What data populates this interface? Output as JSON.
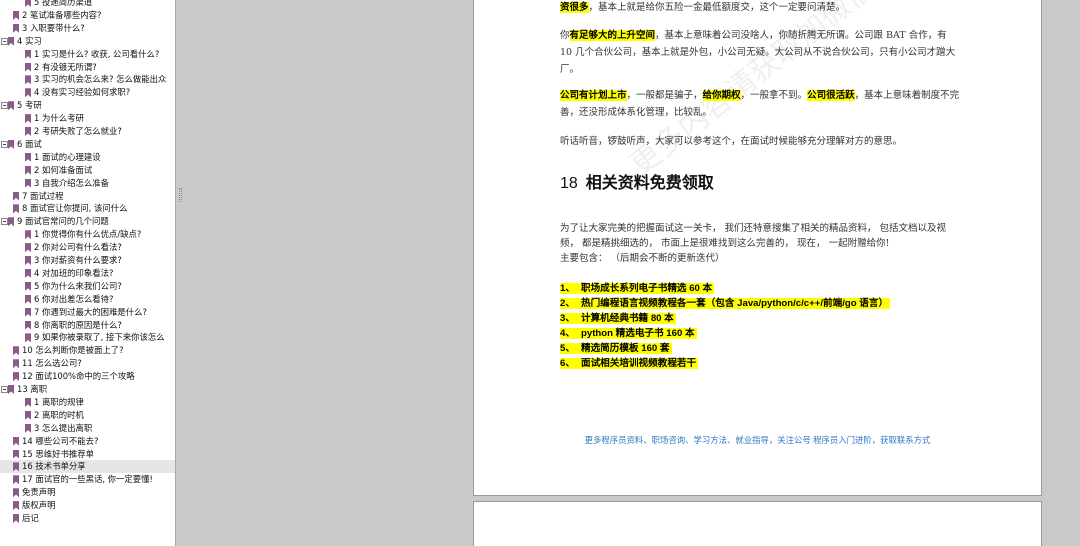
{
  "sidebar": {
    "items": [
      {
        "label": "5 投递简历渠道",
        "level": 2
      },
      {
        "label": "2 笔试准备哪些内容?",
        "level": 1
      },
      {
        "label": "3 入职要带什么?",
        "level": 1
      },
      {
        "label": "4 实习",
        "level": 0,
        "toggle": true
      },
      {
        "label": "1 实习是什么? 收获, 公司看什么?",
        "level": 2
      },
      {
        "label": "2 有没镀无所谓?",
        "level": 2
      },
      {
        "label": "3 实习的机会怎么来? 怎么做能出众",
        "level": 2
      },
      {
        "label": "4 没有实习经验如何求职?",
        "level": 2
      },
      {
        "label": "5 考研",
        "level": 0,
        "toggle": true
      },
      {
        "label": "1 为什么考研",
        "level": 2
      },
      {
        "label": "2 考研失败了怎么就业?",
        "level": 2
      },
      {
        "label": "6 面试",
        "level": 0,
        "toggle": true
      },
      {
        "label": "1 面试的心理建设",
        "level": 2
      },
      {
        "label": "2 如何准备面试",
        "level": 2
      },
      {
        "label": "3 自我介绍怎么准备",
        "level": 2
      },
      {
        "label": "7 面试过程",
        "level": 1
      },
      {
        "label": "8 面试官让你提问, 该问什么",
        "level": 1
      },
      {
        "label": "9 面试官常问的几个问题",
        "level": 0,
        "toggle": true
      },
      {
        "label": "1 你觉得你有什么优点/缺点?",
        "level": 2
      },
      {
        "label": "2 你对公司有什么看法?",
        "level": 2
      },
      {
        "label": "3 你对薪资有什么要求?",
        "level": 2
      },
      {
        "label": "4 对加班的印象看法?",
        "level": 2
      },
      {
        "label": "5 你为什么来我们公司?",
        "level": 2
      },
      {
        "label": "6 你对出差怎么看待?",
        "level": 2
      },
      {
        "label": "7 你遇到过最大的困难是什么?",
        "level": 2
      },
      {
        "label": "8 你离职的原因是什么?",
        "level": 2
      },
      {
        "label": "9 如果你被录取了, 接下来你该怎么",
        "level": 2
      },
      {
        "label": "10 怎么判断你是被面上了?",
        "level": 1
      },
      {
        "label": "11 怎么选公司?",
        "level": 1
      },
      {
        "label": "12 面试100%命中的三个攻略",
        "level": 1
      },
      {
        "label": "13 离职",
        "level": 0,
        "toggle": true
      },
      {
        "label": "1 离职的规律",
        "level": 2
      },
      {
        "label": "2 离职的时机",
        "level": 2
      },
      {
        "label": "3 怎么提出离职",
        "level": 2
      },
      {
        "label": "14 哪些公司不能去?",
        "level": 1
      },
      {
        "label": "15 思维好书推荐单",
        "level": 1
      },
      {
        "label": "16 技术书单分享",
        "level": 1,
        "selected": true
      },
      {
        "label": "17 面试官的一些黑话, 你一定要懂!",
        "level": 1
      },
      {
        "label": "免责声明",
        "level": 1
      },
      {
        "label": "版权声明",
        "level": 1
      },
      {
        "label": "后记",
        "level": 1
      }
    ]
  },
  "document": {
    "p1": {
      "hl": "资很多",
      "rest": "，基本上就是给你五险一金最低额度交，这个一定要问清楚。"
    },
    "p2": {
      "before": "你",
      "hl": "有足够大的上升空间",
      "rest": "，基本上意味着公司没啥人，你随折腾无所谓。公司跟 BAT 合作，有 10 几个合伙公司，基本上就是外包，小公司无疑。大公司从不说合伙公司，只有小公司才蹭大厂。"
    },
    "p3": {
      "hl1": "公司有计划上市",
      "t1": "，一般都是骗子，",
      "hl2": "给你期权",
      "t2": "，一般拿不到。",
      "hl3": "公司很活跃",
      "t3": "，基本上意味着制度不完善，还没形成体系化管理，比较乱。"
    },
    "p4": "听话听音，锣鼓听声，大家可以参考这个，在面试时候能够充分理解对方的意思。",
    "section": {
      "number": "18",
      "title": "相关资料免费领取"
    },
    "intro": "为了让大家完美的把握面试这一关卡， 我们还特意搜集了相关的精品资料， 包括文档以及视频， 都是精挑细选的， 市面上是很难找到这么完善的， 现在， 一起附赠给你!",
    "intro_sub": "主要包含：  （后期会不断的更新迭代）",
    "resources": [
      {
        "num": "1、",
        "text": "职场成长系列电子书精选 60 本"
      },
      {
        "num": "2、",
        "text": "热门编程语言视频教程各一套（包含 Java/python/c/c++/前端/go 语言）"
      },
      {
        "num": "3、",
        "text": "计算机经典书籍 80 本"
      },
      {
        "num": "4、",
        "text": "python 精选电子书 160 本"
      },
      {
        "num": "5、",
        "text": "精选简历模板 160 套"
      },
      {
        "num": "6、",
        "text": "面试相关培训视频教程若干"
      }
    ],
    "footer": "更多程序员资料、职场咨询、学习方法、就业指导，关注公号 程序员入门进阶，获取联系方式",
    "watermark": "更多内容请获取加微信"
  },
  "colors": {
    "highlight": "#ffff00",
    "bookmark": "#8a5a8a",
    "link": "#2a7ac4",
    "viewer_bg": "#c9c9c9"
  }
}
